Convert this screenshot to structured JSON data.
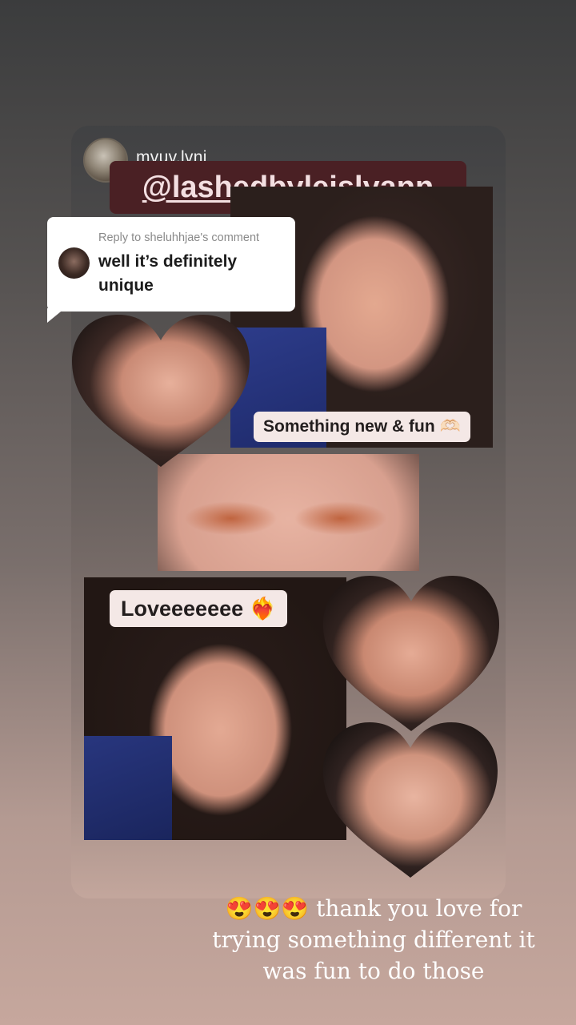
{
  "post": {
    "author": "mvuv.lvni",
    "mention": "@lashedbyleislyann"
  },
  "reply": {
    "header": "Reply to sheluhhjae's comment",
    "text": "well it’s definitely unique"
  },
  "stickers": {
    "top": "Something new & fun 🫶🏻",
    "bottom": "Loveeeeeee ❤️‍🔥"
  },
  "caption": "😍😍😍 thank you love for trying something different it was fun to do those"
}
